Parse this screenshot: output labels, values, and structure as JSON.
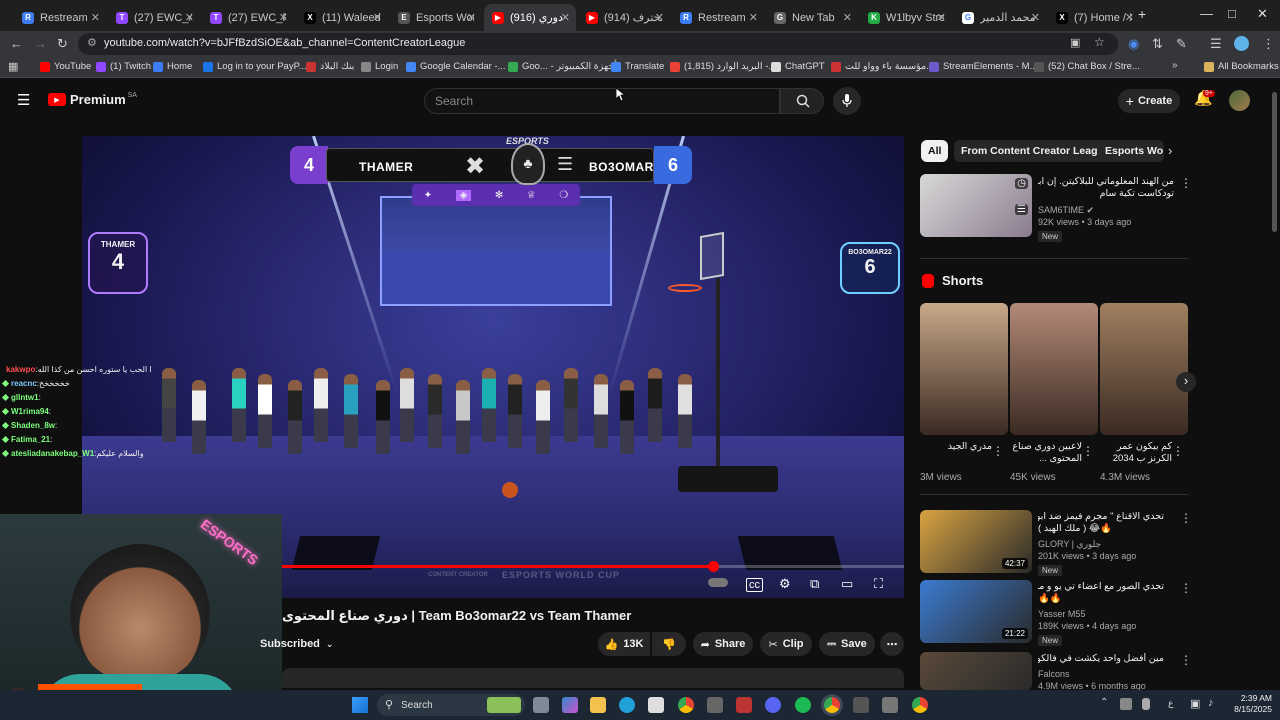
{
  "browser": {
    "tabs": [
      {
        "label": "Restream",
        "color": "#3c7cf5",
        "letter": "R"
      },
      {
        "label": "(27) EWC_Ar",
        "color": "#9146ff",
        "letter": "T"
      },
      {
        "label": "(27) EWC_Pl",
        "color": "#9146ff",
        "letter": "T"
      },
      {
        "label": "(11) Waleed",
        "color": "#000000",
        "letter": "X"
      },
      {
        "label": "Esports Wor",
        "color": "#555555",
        "letter": "E"
      },
      {
        "label": "(916) دوري",
        "color": "#ff0000",
        "letter": "▶"
      },
      {
        "label": "(914) محترف",
        "color": "#ff0000",
        "letter": "▶"
      },
      {
        "label": "Restream",
        "color": "#3c7cf5",
        "letter": "R"
      },
      {
        "label": "New Tab",
        "color": "#666666",
        "letter": "G"
      },
      {
        "label": "W1lbyv Strea",
        "color": "#22aa44",
        "letter": "K"
      },
      {
        "label": "محمد الدمير",
        "color": "#ffffff",
        "letter": "G"
      },
      {
        "label": "(7) Home / X",
        "color": "#000000",
        "letter": "X"
      }
    ],
    "active_tab_index": 5,
    "url": "youtube.com/watch?v=bJFfBzdSiOE&ab_channel=ContentCreatorLeague",
    "bookmarks": [
      {
        "label": "YouTube",
        "color": "#ff0000"
      },
      {
        "label": "(1) Twitch",
        "color": "#9146ff"
      },
      {
        "label": "Home",
        "color": "#3c7cf5"
      },
      {
        "label": "Log in to your PayP...",
        "color": "#1a73e8"
      },
      {
        "label": "بنك البلاد",
        "color": "#cc3333"
      },
      {
        "label": "Login",
        "color": "#888888"
      },
      {
        "label": "Google Calendar -...",
        "color": "#4285f4"
      },
      {
        "label": "Goo... - أجهزة الكمبيوتر",
        "color": "#34a853"
      },
      {
        "label": "Translate",
        "color": "#4285f4"
      },
      {
        "label": "(1,815) البريد الوارد -...",
        "color": "#ea4335"
      },
      {
        "label": "ChatGPT",
        "color": "#dddddd"
      },
      {
        "label": "مؤسسة باء وواو للت...",
        "color": "#cc3333"
      },
      {
        "label": "StreamElements - M...",
        "color": "#6a5acd"
      },
      {
        "label": "(52) Chat Box / Stre...",
        "color": "#555555"
      }
    ],
    "all_bookmarks_label": "All Bookmarks"
  },
  "youtube": {
    "logo_label": "Premium",
    "region": "SA",
    "search_placeholder": "Search",
    "create_label": "Create",
    "notif_count": "9+"
  },
  "video": {
    "team_left": "THAMER",
    "team_right": "BO3OMAR22",
    "score_left": "4",
    "score_right": "6",
    "side_left_name": "THAMER",
    "side_left_score": "4",
    "side_right_name": "BO3OMAR22",
    "side_right_score": "6",
    "brand_top": "ESPORTS",
    "floor_brand_a": "CONTENT CREATOR",
    "floor_brand_b": "ESPORTS WORLD CUP",
    "progress_fraction": 0.768,
    "title": "دوري صناع المحتوى | Team Bo3omar22 vs Team Thamer",
    "subscribed_label": "Subscribed",
    "likes": "13K",
    "share_label": "Share",
    "clip_label": "Clip",
    "save_label": "Save"
  },
  "stream_overlay": {
    "chat": [
      {
        "user": "kakwpo",
        "text": "وش ذا الحب يا ستوره احسن من كذا الله",
        "color": "#ff4d4d"
      },
      {
        "user": "reacnc",
        "text": "خخخخخخ",
        "color": "#7ec8ff"
      },
      {
        "user": "gllntw1",
        "text": "",
        "color": "#7dff7d"
      },
      {
        "user": "W1rima94",
        "text": "",
        "color": "#7dff7d"
      },
      {
        "user": "Shaden_8w",
        "text": "",
        "color": "#7dff7d"
      },
      {
        "user": "Fatima_21",
        "text": "",
        "color": "#7dff7d"
      },
      {
        "user": "atesliadanakebap_W1",
        "text": "والسلام عليكم",
        "color": "#7dff7d"
      }
    ],
    "webcam_badge": "ESPORTS",
    "sponsor": "steelseries"
  },
  "sidebar": {
    "chips": [
      "All",
      "From Content Creator League",
      "Esports Wo"
    ],
    "top_video": {
      "title_line1": "من الهند المعلوماتي للبلاكيتن. إن ابو سجد في",
      "title_line2": "تودكاست تكية سام",
      "channel": "SAM6TIME",
      "meta": "92K views • 3 days ago",
      "badge": "New"
    },
    "shorts_heading": "Shorts",
    "shorts": [
      {
        "title": "مدري الجيد",
        "views": "3M views",
        "color": "#c9a98a"
      },
      {
        "title": "لاعبين دوري صناع المحتوى ...",
        "views": "45K views",
        "color": "#b48a78"
      },
      {
        "title": "كم بيكون عمر الكرنز ب 2034",
        "views": "4.3M views",
        "color": "#a08060"
      }
    ],
    "videos": [
      {
        "title_line1": "تحدي الاقناع \" مجرم فيمز ضد ابو عابد",
        "title_line2": "( ملك الهبد ) 😂🔥",
        "channel": "GLORY | جلوري",
        "meta": "201K views • 3 days ago",
        "badge": "New",
        "duration": "42:37",
        "color": "#d9a441"
      },
      {
        "title_line1": "تحدي الصور مع اعضاء تي يو و مدير العالم",
        "title_line2": "🔥🔥",
        "channel": "Yasser M55",
        "meta": "189K views • 4 days ago",
        "badge": "New",
        "duration": "21:22",
        "color": "#3b7bd1"
      },
      {
        "title_line1": "مين أفضل واحد يكشت في فالكونز ؟",
        "title_line2": "",
        "channel": "Falcons",
        "meta": "4.9M views • 6 months ago",
        "badge": "",
        "duration": "",
        "color": "#5a4a3a"
      }
    ]
  },
  "taskbar": {
    "search_placeholder": "Search",
    "time": "2:39 AM",
    "date": "8/15/2025"
  }
}
